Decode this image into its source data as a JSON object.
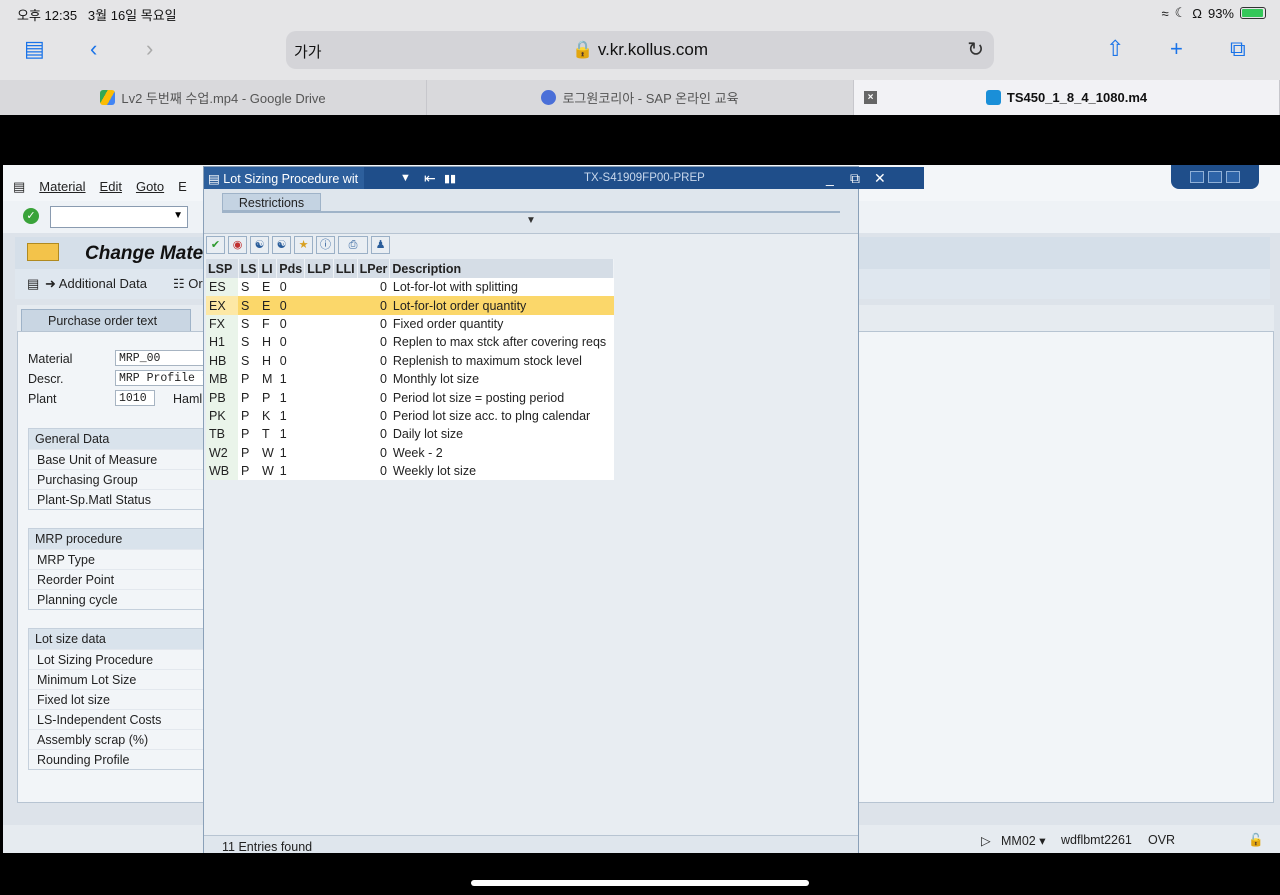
{
  "status": {
    "time": "오후 12:35",
    "date": "3월 16일 목요일",
    "battery": "93%"
  },
  "browser": {
    "text_size": "가가",
    "url": "v.kr.kollus.com",
    "tabs": [
      {
        "label": "Lv2 두번째 수업.mp4 - Google Drive"
      },
      {
        "label": "로그원코리아 - SAP 온라인 교육"
      },
      {
        "label": "TS450_1_8_4_1080.m4"
      }
    ]
  },
  "sap": {
    "menu": [
      "Material",
      "Edit",
      "Goto",
      "E"
    ],
    "page_title": "Change Mate",
    "app_toolbar": {
      "additional_data": "Additional Data",
      "org": "Or"
    },
    "tab_label": "Purchase order text",
    "fields": {
      "material_label": "Material",
      "material_value": "MRP_00",
      "descr_label": "Descr.",
      "descr_value": "MRP Profile tes",
      "plant_label": "Plant",
      "plant_value": "1010",
      "plant_name": "Haml"
    },
    "groups": {
      "general": {
        "title": "General Data",
        "rows": [
          "Base Unit of Measure",
          "Purchasing Group",
          "Plant-Sp.Matl Status"
        ]
      },
      "mrp": {
        "title": "MRP procedure",
        "rows": [
          "MRP Type",
          "Reorder Point",
          "Planning cycle"
        ]
      },
      "lotsize": {
        "title": "Lot size data",
        "rows": [
          "Lot Sizing Procedure",
          "Minimum Lot Size",
          "Fixed lot size",
          "LS-Independent Costs",
          "Assembly scrap (%)",
          "Rounding Profile"
        ]
      }
    },
    "statusbar": {
      "tcode": "MM02",
      "server": "wdflbmt2261",
      "mode": "OVR"
    }
  },
  "popup": {
    "title": "Lot Sizing Procedure wit",
    "system": "TX-S41909FP00-PREP",
    "restrictions_tab": "Restrictions",
    "columns": [
      "LSP",
      "LS",
      "LI",
      "Pds",
      "LLP",
      "LLI",
      "LPer",
      "Description"
    ],
    "rows": [
      {
        "lsp": "ES",
        "ls": "S",
        "li": "E",
        "pds": "0",
        "llp": "",
        "lli": "",
        "lper": "0",
        "desc": "Lot-for-lot with splitting"
      },
      {
        "lsp": "EX",
        "ls": "S",
        "li": "E",
        "pds": "0",
        "llp": "",
        "lli": "",
        "lper": "0",
        "desc": "Lot-for-lot order quantity",
        "selected": true
      },
      {
        "lsp": "FX",
        "ls": "S",
        "li": "F",
        "pds": "0",
        "llp": "",
        "lli": "",
        "lper": "0",
        "desc": "Fixed order quantity"
      },
      {
        "lsp": "H1",
        "ls": "S",
        "li": "H",
        "pds": "0",
        "llp": "",
        "lli": "",
        "lper": "0",
        "desc": "Replen to max stck after covering reqs"
      },
      {
        "lsp": "HB",
        "ls": "S",
        "li": "H",
        "pds": "0",
        "llp": "",
        "lli": "",
        "lper": "0",
        "desc": "Replenish to maximum stock level"
      },
      {
        "lsp": "MB",
        "ls": "P",
        "li": "M",
        "pds": "1",
        "llp": "",
        "lli": "",
        "lper": "0",
        "desc": "Monthly lot size"
      },
      {
        "lsp": "PB",
        "ls": "P",
        "li": "P",
        "pds": "1",
        "llp": "",
        "lli": "",
        "lper": "0",
        "desc": "Period lot size = posting period"
      },
      {
        "lsp": "PK",
        "ls": "P",
        "li": "K",
        "pds": "1",
        "llp": "",
        "lli": "",
        "lper": "0",
        "desc": "Period lot size acc. to plng calendar"
      },
      {
        "lsp": "TB",
        "ls": "P",
        "li": "T",
        "pds": "1",
        "llp": "",
        "lli": "",
        "lper": "0",
        "desc": "Daily lot size"
      },
      {
        "lsp": "W2",
        "ls": "P",
        "li": "W",
        "pds": "1",
        "llp": "",
        "lli": "",
        "lper": "0",
        "desc": "Week - 2"
      },
      {
        "lsp": "WB",
        "ls": "P",
        "li": "W",
        "pds": "1",
        "llp": "",
        "lli": "",
        "lper": "0",
        "desc": "Weekly lot size"
      }
    ],
    "entries_found": "11 Entries found"
  }
}
